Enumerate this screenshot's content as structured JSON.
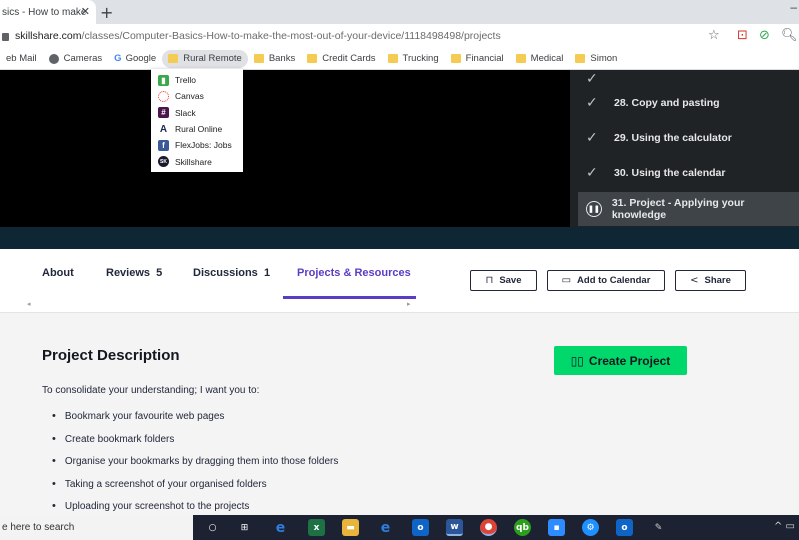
{
  "browser": {
    "tab_title": "sics - How to make",
    "tab_close": "✕",
    "new_tab": "+",
    "url_domain": "skillshare.com",
    "url_path": "/classes/Computer-Basics-How-to-make-the-most-out-of-your-device/1118498498/projects"
  },
  "bookmarks": [
    {
      "label": "eb Mail",
      "icon": "mail-icon"
    },
    {
      "label": "Cameras",
      "icon": "globe-icon"
    },
    {
      "label": "Google",
      "icon": "google-icon"
    },
    {
      "label": "Rural Remote",
      "icon": "folder-icon",
      "active": true
    },
    {
      "label": "Banks",
      "icon": "folder-icon"
    },
    {
      "label": "Credit Cards",
      "icon": "folder-icon"
    },
    {
      "label": "Trucking",
      "icon": "folder-icon"
    },
    {
      "label": "Financial",
      "icon": "folder-icon"
    },
    {
      "label": "Medical",
      "icon": "folder-icon"
    },
    {
      "label": "Simon",
      "icon": "folder-icon"
    }
  ],
  "dropdown": [
    {
      "label": "Trello",
      "icon": "trello-icon",
      "color": "#37a84b"
    },
    {
      "label": "Canvas",
      "icon": "canvas-icon",
      "color": "#e03d2f"
    },
    {
      "label": "Slack",
      "icon": "slack-icon",
      "color": "#4a154b"
    },
    {
      "label": "Rural Online",
      "icon": "rural-online-icon",
      "color": "#1b2a4a"
    },
    {
      "label": "FlexJobs: Jobs",
      "icon": "flexjobs-icon",
      "color": "#3b5998"
    },
    {
      "label": "Skillshare",
      "icon": "skillshare-icon",
      "color": "#1a1a2e"
    }
  ],
  "playlist": [
    {
      "label": "28. Copy and pasting",
      "status": "done"
    },
    {
      "label": "29. Using the calculator",
      "status": "done"
    },
    {
      "label": "30. Using the calendar",
      "status": "done"
    },
    {
      "label": "31. Project - Applying your knowledge",
      "status": "playing"
    }
  ],
  "class_tabs": {
    "about": "About",
    "reviews": "Reviews",
    "reviews_count": "5",
    "discussions": "Discussions",
    "discussions_count": "1",
    "projects": "Projects & Resources"
  },
  "actions": {
    "save": "Save",
    "calendar": "Add to Calendar",
    "share": "Share"
  },
  "project": {
    "title": "Project Description",
    "create_button": "Create Project",
    "intro": "To consolidate your understanding; I want you to:",
    "bullets": [
      "Bookmark your favourite web pages",
      "Create bookmark folders",
      "Organise your bookmarks by dragging them into those folders",
      "Taking a screenshot of your organised folders",
      "Uploading your screenshot to the projects"
    ]
  },
  "taskbar": {
    "search_placeholder": "e here to search"
  },
  "colors": {
    "accent": "#5b3cc4",
    "create_button": "#00d86c",
    "player_bg": "#000000",
    "playlist_bg": "#1f2326"
  }
}
